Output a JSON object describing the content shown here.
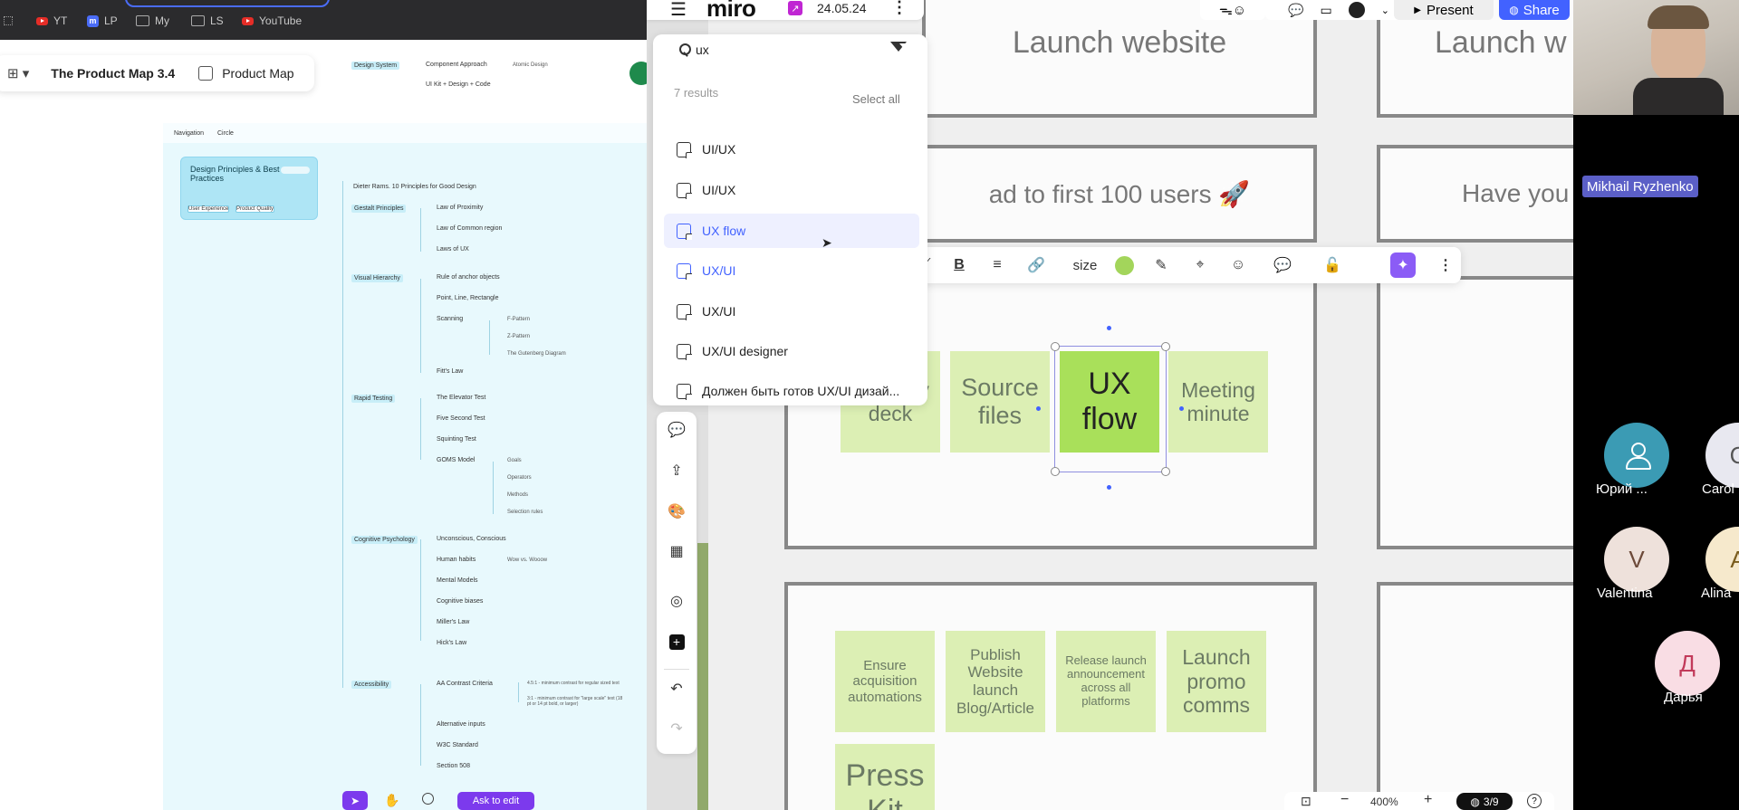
{
  "left_browser": {
    "bookmarks": [
      "YT",
      "LP",
      "My",
      "LS",
      "YouTube"
    ],
    "breadcrumb_parent": "The Product Map 3.4",
    "breadcrumb_current": "Product Map",
    "map": {
      "design_system": "Design System",
      "component_approach": "Component Approach",
      "atomic_design": "Atomic Design",
      "ui_kit": "UI Kit + Design + Code",
      "strip_left": "Navigation",
      "strip_right": "Circle",
      "card_title": "Design Principles & Best Practices",
      "card_tag1": "User Experience",
      "card_tag2": "Product Quality",
      "dieter": "Dieter Rams. 10 Principles for Good Design",
      "gestalt": "Gestalt Principles",
      "law_proximity": "Law of Proximity",
      "law_common": "Law of Common region",
      "laws_ux": "Laws of UX",
      "visual_hierarchy": "Visual Hierarchy",
      "rule_anchor": "Rule of anchor objects",
      "point_line": "Point, Line, Rectangle",
      "scanning": "Scanning",
      "f_pattern": "F-Pattern",
      "z_pattern": "Z-Pattern",
      "gutenberg": "The Gutenberg Diagram",
      "fitts": "Fitt's Law",
      "rapid_testing": "Rapid Testing",
      "elevator": "The Elevator Test",
      "five_second": "Five Second Test",
      "squinting": "Squinting Test",
      "goms": "GOMS Model",
      "goals": "Goals",
      "operators": "Operators",
      "methods": "Methods",
      "selection_rules": "Selection rules",
      "cognitive": "Cognitive Psychology",
      "unconscious": "Unconscious, Conscious",
      "human_habits": "Human habits",
      "habits_sub": "Wow vs. Wooow",
      "mental_models": "Mental Models",
      "cognitive_biases": "Cognitive biases",
      "millers": "Miller's Law",
      "hicks": "Hick's Law",
      "accessibility": "Accessibility",
      "aa_contrast": "AA Contrast Criteria",
      "contrast_note1": "4.5:1 - minimum contrast for regular sized text",
      "contrast_note2": "3:1 - minimum contrast for \"large scale\" text (18 pt or 14 pt bold, or larger)",
      "alt_inputs": "Alternative inputs",
      "w3c": "W3C Standard",
      "section508": "Section 508"
    },
    "ask_button": "Ask to edit"
  },
  "miro": {
    "menu_icon": "hamburger-icon",
    "logo": "miro",
    "date": "24.05.24",
    "search": {
      "query": "ux",
      "results_count": "7 results",
      "select_all": "Select all",
      "results": [
        "UI/UX",
        "UI/UX",
        "UX flow",
        "UX/UI",
        "UX/UI",
        "UX/UI designer",
        "Должен быть готов UX/UI дизай..."
      ],
      "selected_index": 2
    },
    "top_right": {
      "present": "Present",
      "share": "Share"
    },
    "context_toolbar": {
      "size_label": "size",
      "color": "#a3d55b"
    },
    "frames": {
      "launch_website": "Launch website",
      "launch_w": "Launch w",
      "first_100": "ad to first 100 users 🚀",
      "have_you": "Have you"
    },
    "stickies": {
      "strategy_deck": "Strategy deck",
      "source_files": "Source files",
      "ux_flow": "UX flow",
      "meeting_minute": "Meeting minute",
      "ensure_acq": "Ensure acquisition automations",
      "publish_site": "Publish Website launch Blog/Article",
      "release_launch": "Release launch announcement across all platforms",
      "launch_promo": "Launch promo comms",
      "press_kit": "Press Kit"
    },
    "zoom": {
      "level": "400%",
      "pages": "3/9"
    },
    "colors": {
      "sticky": "#dcefb4",
      "sticky_selected": "#a9e05a",
      "accent": "#4262ff"
    }
  },
  "video": {
    "speaker_name": "Mikhail Ryzhenko",
    "participants": [
      {
        "name": "Юрий ...",
        "initial": ""
      },
      {
        "name": "Carol",
        "initial": "C"
      },
      {
        "name": "Valentina",
        "initial": "V"
      },
      {
        "name": "Alina",
        "initial": "A"
      },
      {
        "name": "Дарья",
        "initial": "Д"
      }
    ]
  }
}
